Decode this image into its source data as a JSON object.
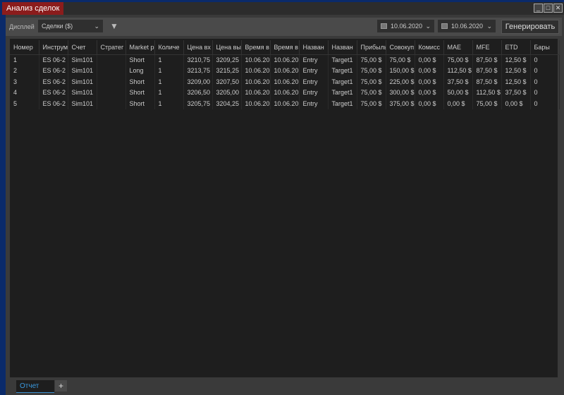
{
  "window": {
    "title": "Анализ сделок",
    "controls": [
      "_",
      "□",
      "✕"
    ]
  },
  "toolbar": {
    "display_label": "Дисплей",
    "display_value": "Сделки ($)",
    "filter_icon": "filter-icon",
    "date_from": "10.06.2020",
    "date_to": "10.06.2020",
    "generate_label": "Генерировать"
  },
  "table": {
    "headers": [
      "Номер",
      "Инструм",
      "Счет",
      "Стратег",
      "Market p",
      "Количе",
      "Цена вх",
      "Цена вы",
      "Время в",
      "Время в",
      "Назван",
      "Назван",
      "Прибыль",
      "Совокуп",
      "Комисс",
      "MAE",
      "MFE",
      "ETD",
      "Бары"
    ],
    "rows": [
      [
        "1",
        "ES 06-2",
        "Sim101",
        "",
        "Short",
        "1",
        "3210,75",
        "3209,25",
        "10.06.20",
        "10.06.20",
        "Entry",
        "Target1",
        "75,00 $",
        "75,00 $",
        "0,00 $",
        "75,00 $",
        "87,50 $",
        "12,50 $",
        "0"
      ],
      [
        "2",
        "ES 06-2",
        "Sim101",
        "",
        "Long",
        "1",
        "3213,75",
        "3215,25",
        "10.06.20",
        "10.06.20",
        "Entry",
        "Target1",
        "75,00 $",
        "150,00 $",
        "0,00 $",
        "112,50 $",
        "87,50 $",
        "12,50 $",
        "0"
      ],
      [
        "3",
        "ES 06-2",
        "Sim101",
        "",
        "Short",
        "1",
        "3209,00",
        "3207,50",
        "10.06.20",
        "10.06.20",
        "Entry",
        "Target1",
        "75,00 $",
        "225,00 $",
        "0,00 $",
        "37,50 $",
        "87,50 $",
        "12,50 $",
        "0"
      ],
      [
        "4",
        "ES 06-2",
        "Sim101",
        "",
        "Short",
        "1",
        "3206,50",
        "3205,00",
        "10.06.20",
        "10.06.20",
        "Entry",
        "Target1",
        "75,00 $",
        "300,00 $",
        "0,00 $",
        "50,00 $",
        "112,50 $",
        "37,50 $",
        "0"
      ],
      [
        "5",
        "ES 06-2",
        "Sim101",
        "",
        "Short",
        "1",
        "3205,75",
        "3204,25",
        "10.06.20",
        "10.06.20",
        "Entry",
        "Target1",
        "75,00 $",
        "375,00 $",
        "0,00 $",
        "0,00 $",
        "75,00 $",
        "0,00 $",
        "0"
      ]
    ]
  },
  "tabs": {
    "items": [
      "Отчет"
    ],
    "add": "+"
  }
}
